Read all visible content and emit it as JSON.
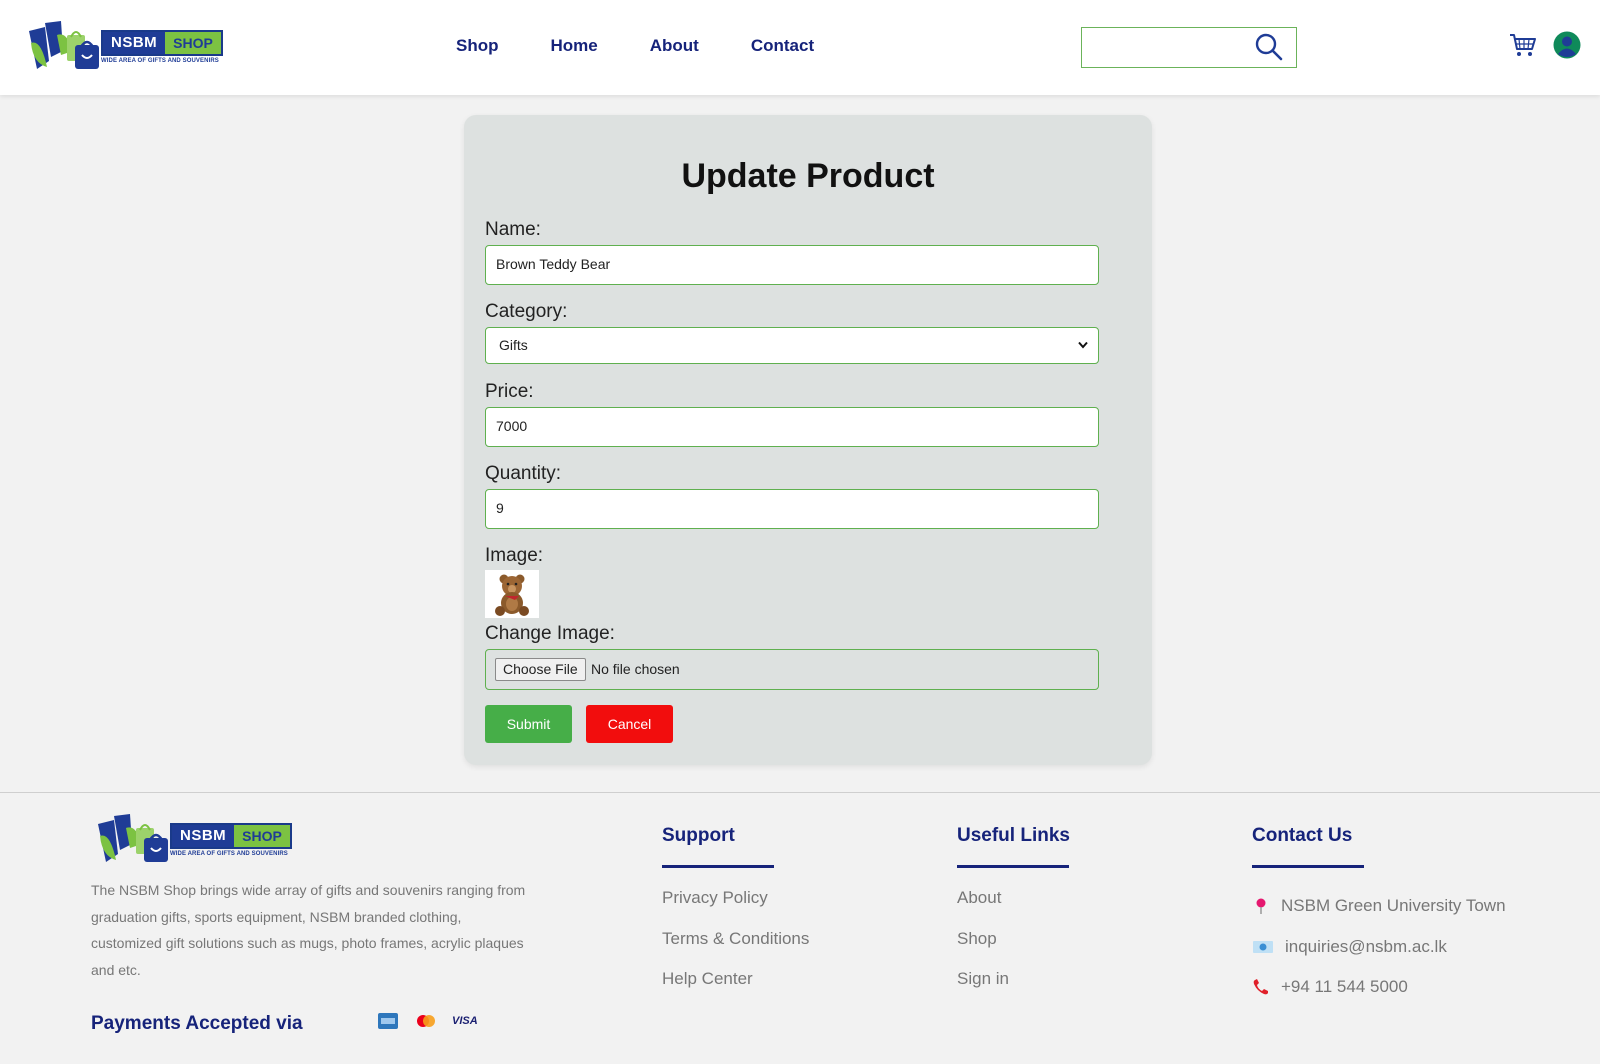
{
  "header": {
    "logo": {
      "brand": "NSBM",
      "shop": "SHOP",
      "tagline": "WIDE AREA OF GIFTS AND SOUVENIRS"
    },
    "nav": [
      {
        "label": "Shop"
      },
      {
        "label": "Home"
      },
      {
        "label": "About"
      },
      {
        "label": "Contact"
      }
    ],
    "search": {
      "value": "",
      "placeholder": ""
    },
    "icons": {
      "search": "search-icon",
      "cart": "cart-icon",
      "user": "user-avatar-icon"
    }
  },
  "form": {
    "title": "Update Product",
    "name_label": "Name:",
    "name_value": "Brown Teddy Bear",
    "category_label": "Category:",
    "category_value": "Gifts",
    "price_label": "Price:",
    "price_value": "7000",
    "quantity_label": "Quantity:",
    "quantity_value": "9",
    "image_label": "Image:",
    "change_image_label": "Change Image:",
    "file_button": "Choose File",
    "file_status": "No file chosen",
    "submit_label": "Submit",
    "cancel_label": "Cancel"
  },
  "footer": {
    "logo": {
      "brand": "NSBM",
      "shop": "SHOP",
      "tagline": "WIDE AREA OF GIFTS AND SOUVENIRS"
    },
    "description": "The NSBM Shop brings wide array of gifts and souvenirs ranging from graduation gifts, sports equipment, NSBM branded clothing, customized gift solutions such as mugs, photo frames, acrylic plaques and etc.",
    "payments_label": "Payments Accepted via",
    "payment_icons": [
      "amex-icon",
      "mastercard-icon",
      "visa-icon"
    ],
    "visa_text": "VISA",
    "support": {
      "title": "Support",
      "links": [
        "Privacy Policy",
        "Terms & Conditions",
        "Help Center"
      ]
    },
    "useful_links": {
      "title": "Useful Links",
      "links": [
        "About",
        "Shop",
        "Sign in"
      ]
    },
    "contact": {
      "title": "Contact Us",
      "items": [
        {
          "icon": "location-pin-icon",
          "text": "NSBM Green University Town"
        },
        {
          "icon": "email-icon",
          "text": "inquiries@nsbm.ac.lk"
        },
        {
          "icon": "phone-icon",
          "text": "+94 11 544 5000"
        }
      ]
    }
  },
  "colors": {
    "nav_text": "#16237a",
    "accent_green": "#46ae48",
    "cancel_red": "#f20d0d",
    "card_bg": "#dde1e0"
  }
}
